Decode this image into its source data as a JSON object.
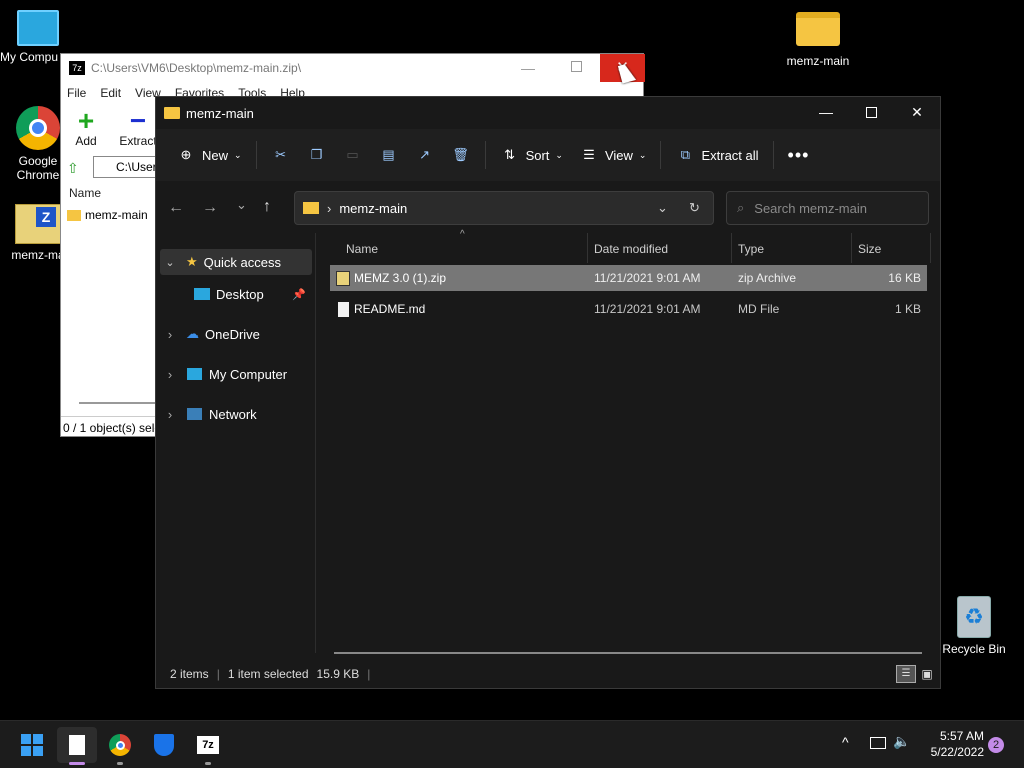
{
  "desktop": {
    "icons": [
      {
        "label": "My Compu"
      },
      {
        "label": "Google Chrome"
      },
      {
        "label": "memz-ma"
      },
      {
        "label": "memz-main"
      },
      {
        "label": "Recycle Bin"
      }
    ]
  },
  "zip_window": {
    "title": "C:\\Users\\VM6\\Desktop\\memz-main.zip\\",
    "menu": [
      "File",
      "Edit",
      "View",
      "Favorites",
      "Tools",
      "Help"
    ],
    "toolbar": {
      "add": "Add",
      "extract": "Extract"
    },
    "path": "C:\\User",
    "col_name": "Name",
    "item": "memz-main",
    "status": "0 / 1 object(s) sele"
  },
  "explorer": {
    "title": "memz-main",
    "cmd": {
      "new": "New",
      "sort": "Sort",
      "view": "View",
      "extract_all": "Extract all"
    },
    "address": "memz-main",
    "search_placeholder": "Search memz-main",
    "nav": {
      "quick_access": "Quick access",
      "desktop": "Desktop",
      "onedrive": "OneDrive",
      "my_computer": "My Computer",
      "network": "Network"
    },
    "columns": {
      "name": "Name",
      "date": "Date modified",
      "type": "Type",
      "size": "Size"
    },
    "files": [
      {
        "name": "MEMZ 3.0 (1).zip",
        "date": "11/21/2021 9:01 AM",
        "type": "zip Archive",
        "size": "16 KB"
      },
      {
        "name": "README.md",
        "date": "11/21/2021 9:01 AM",
        "type": "MD File",
        "size": "1 KB"
      }
    ],
    "status": {
      "items": "2 items",
      "selected": "1 item selected",
      "size": "15.9 KB"
    }
  },
  "taskbar": {
    "time": "5:57 AM",
    "date": "5/22/2022",
    "badge": "2"
  }
}
